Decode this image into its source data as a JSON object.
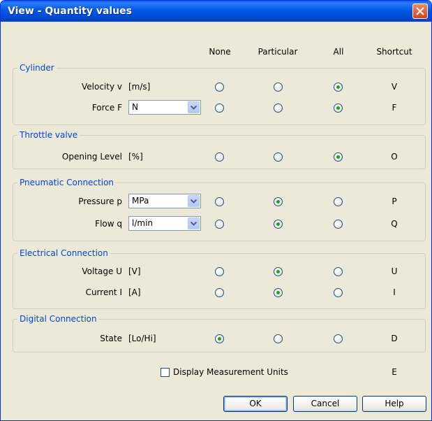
{
  "window": {
    "title": "View - Quantity values"
  },
  "columns": {
    "none": "None",
    "particular": "Particular",
    "all": "All",
    "shortcut": "Shortcut"
  },
  "groups": {
    "cylinder": {
      "title": "Cylinder",
      "velocity": {
        "label": "Velocity v",
        "unit": "[m/s]",
        "selected": "All",
        "shortcut": "V"
      },
      "force": {
        "label": "Force F",
        "unit_select": "N",
        "selected": "All",
        "shortcut": "F"
      }
    },
    "throttle": {
      "title": "Throttle valve",
      "opening": {
        "label": "Opening Level",
        "unit": "[%]",
        "selected": "All",
        "shortcut": "O"
      }
    },
    "pneumatic": {
      "title": "Pneumatic Connection",
      "pressure": {
        "label": "Pressure p",
        "unit_select": "MPa",
        "selected": "Particular",
        "shortcut": "P"
      },
      "flow": {
        "label": "Flow q",
        "unit_select": "l/min",
        "selected": "Particular",
        "shortcut": "Q"
      }
    },
    "electrical": {
      "title": "Electrical Connection",
      "voltage": {
        "label": "Voltage U",
        "unit": "[V]",
        "selected": "Particular",
        "shortcut": "U"
      },
      "current": {
        "label": "Current I",
        "unit": "[A]",
        "selected": "Particular",
        "shortcut": "I"
      }
    },
    "digital": {
      "title": "Digital Connection",
      "state": {
        "label": "State",
        "unit": "[Lo/Hi]",
        "selected": "None",
        "shortcut": "D"
      }
    }
  },
  "display_units": {
    "label": "Display Measurement Units",
    "checked": false,
    "shortcut": "E"
  },
  "buttons": {
    "ok": "OK",
    "cancel": "Cancel",
    "help": "Help"
  },
  "colors": {
    "title_bar": "#0054e3",
    "group_title": "#0046d5",
    "radio_dot": "#21a121",
    "close": "#e0502a"
  }
}
